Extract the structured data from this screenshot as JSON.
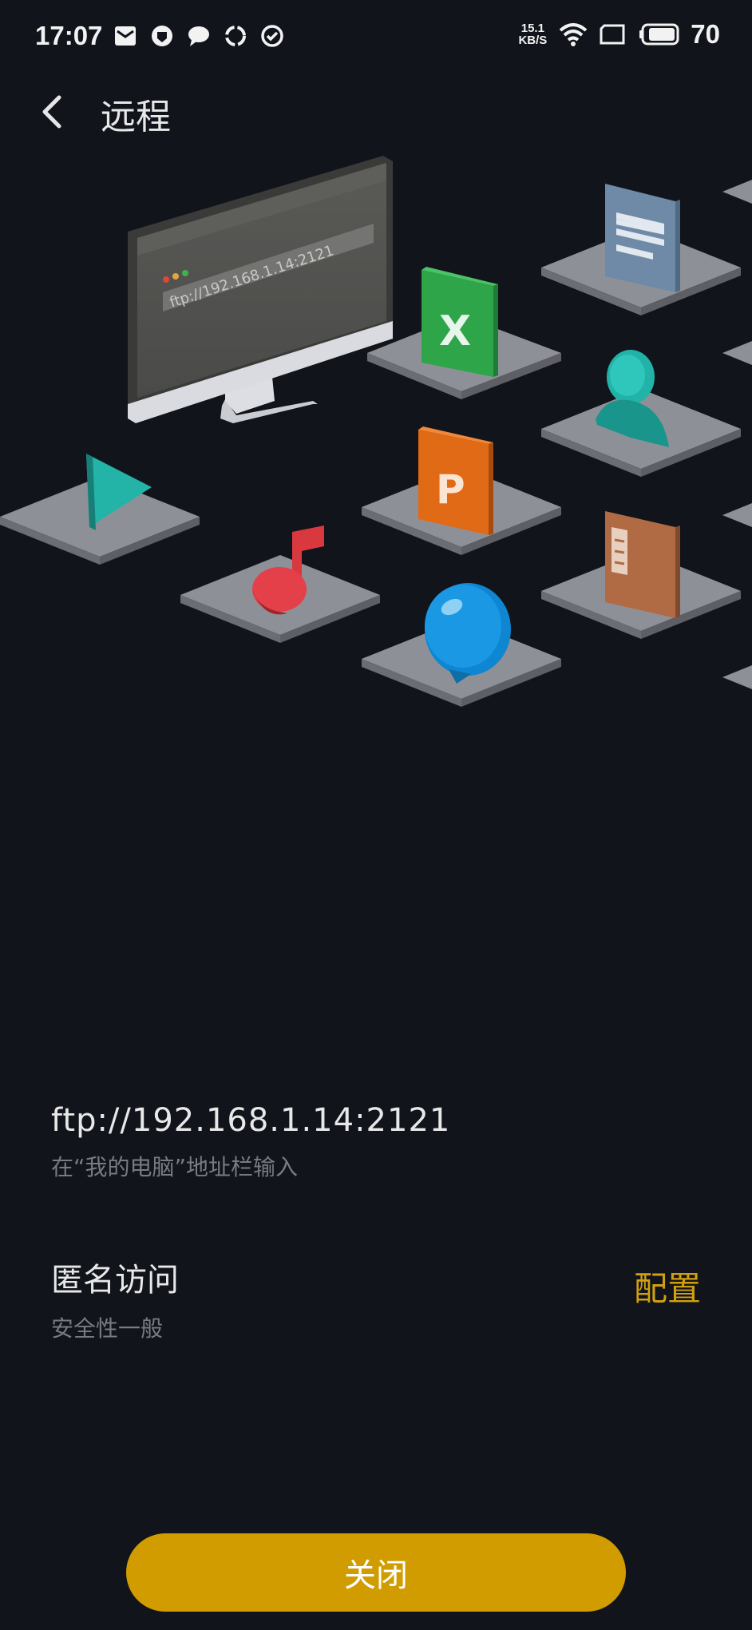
{
  "status_bar": {
    "time": "17:07",
    "network_speed_value": "15.1",
    "network_speed_unit": "KB/S",
    "battery_level": "70",
    "icons": [
      "mail-icon",
      "shield-icon",
      "chat-icon",
      "sync-icon",
      "check-circle-icon",
      "wifi-icon",
      "screen-icon",
      "battery-icon"
    ]
  },
  "app_bar": {
    "title": "远程"
  },
  "illustration": {
    "monitor_address": "ftp://192.168.1.14:2121",
    "tiles": [
      "video-icon",
      "music-icon",
      "excel-icon",
      "powerpoint-icon",
      "bubble-icon",
      "document-icon",
      "contact-icon",
      "archive-icon"
    ]
  },
  "ftp": {
    "address": "ftp://192.168.1.14:2121",
    "hint": "在“我的电脑”地址栏输入"
  },
  "access": {
    "title": "匿名访问",
    "subtitle": "安全性一般",
    "config_label": "配置"
  },
  "actions": {
    "close_label": "关闭"
  },
  "colors": {
    "background": "#11141b",
    "accent": "#d19c00",
    "config_text": "#d1a010",
    "secondary_text": "#777b83"
  }
}
